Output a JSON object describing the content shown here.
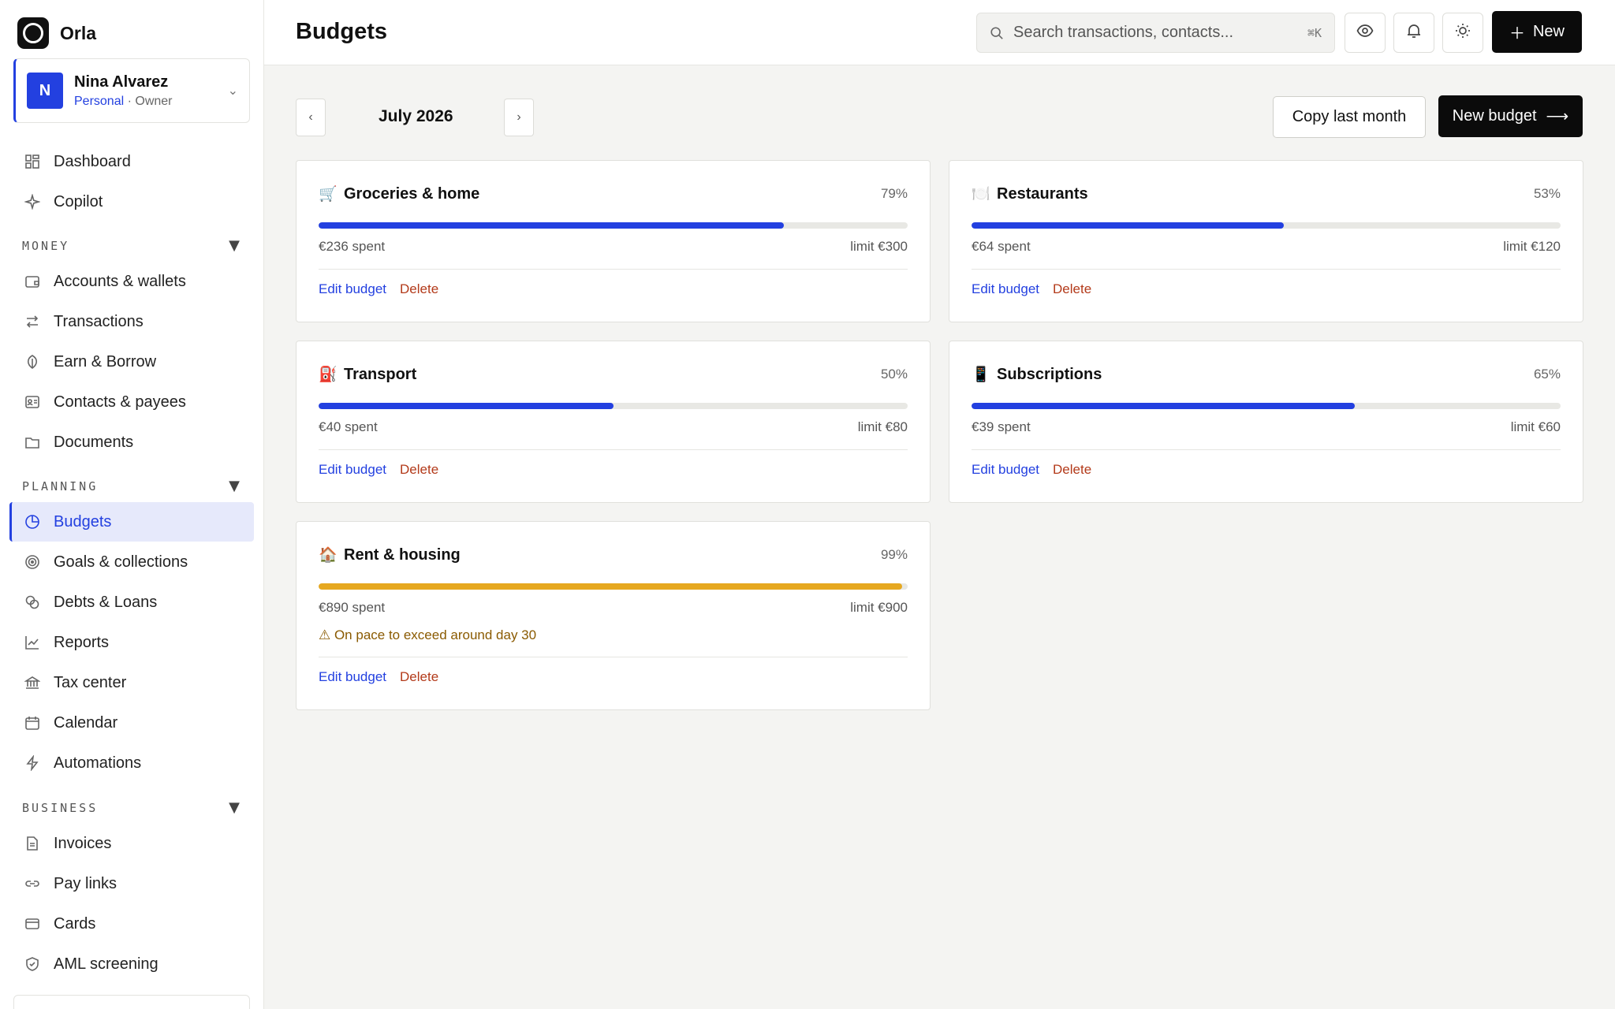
{
  "brand": {
    "name": "Orla"
  },
  "account": {
    "initial": "N",
    "name": "Nina Alvarez",
    "type": "Personal",
    "role": " · Owner"
  },
  "nav": {
    "top": [
      {
        "label": "Dashboard"
      },
      {
        "label": "Copilot"
      }
    ],
    "money_label": "MONEY",
    "money": [
      {
        "label": "Accounts & wallets"
      },
      {
        "label": "Transactions"
      },
      {
        "label": "Earn & Borrow"
      },
      {
        "label": "Contacts & payees"
      },
      {
        "label": "Documents"
      }
    ],
    "planning_label": "PLANNING",
    "planning": [
      {
        "label": "Budgets"
      },
      {
        "label": "Goals & collections"
      },
      {
        "label": "Debts & Loans"
      },
      {
        "label": "Reports"
      },
      {
        "label": "Tax center"
      },
      {
        "label": "Calendar"
      },
      {
        "label": "Automations"
      }
    ],
    "business_label": "BUSINESS",
    "business": [
      {
        "label": "Invoices"
      },
      {
        "label": "Pay links"
      },
      {
        "label": "Cards"
      },
      {
        "label": "AML screening"
      }
    ]
  },
  "header": {
    "title": "Budgets",
    "search_placeholder": "Search transactions, contacts...",
    "search_shortcut": "⌘K",
    "new_label": "New"
  },
  "toolbar": {
    "prev": "‹",
    "next": "›",
    "month": "July 2026",
    "copy_label": "Copy last month",
    "new_budget_label": "New budget"
  },
  "budgets": [
    {
      "emoji": "🛒",
      "name": "Groceries & home",
      "pct_label": "79%",
      "progress": 0.79,
      "spent": "€236 spent",
      "limit": "limit €300",
      "edit": "Edit budget",
      "delete": "Delete"
    },
    {
      "emoji": "🍽️",
      "name": "Restaurants",
      "pct_label": "53%",
      "progress": 0.53,
      "spent": "€64 spent",
      "limit": "limit €120",
      "edit": "Edit budget",
      "delete": "Delete"
    },
    {
      "emoji": "⛽",
      "name": "Transport",
      "pct_label": "50%",
      "progress": 0.5,
      "spent": "€40 spent",
      "limit": "limit €80",
      "edit": "Edit budget",
      "delete": "Delete"
    },
    {
      "emoji": "📱",
      "name": "Subscriptions",
      "pct_label": "65%",
      "progress": 0.65,
      "spent": "€39 spent",
      "limit": "limit €60",
      "edit": "Edit budget",
      "delete": "Delete"
    },
    {
      "emoji": "🏠",
      "name": "Rent & housing",
      "pct_label": "99%",
      "progress": 0.99,
      "spent": "€890 spent",
      "limit": "limit €900",
      "warning": "⚠ On pace to exceed around day 30",
      "edit": "Edit budget",
      "delete": "Delete"
    }
  ],
  "colors": {
    "accent": "#2340e0",
    "warning": "#e6a820",
    "danger": "#b33a1a"
  }
}
